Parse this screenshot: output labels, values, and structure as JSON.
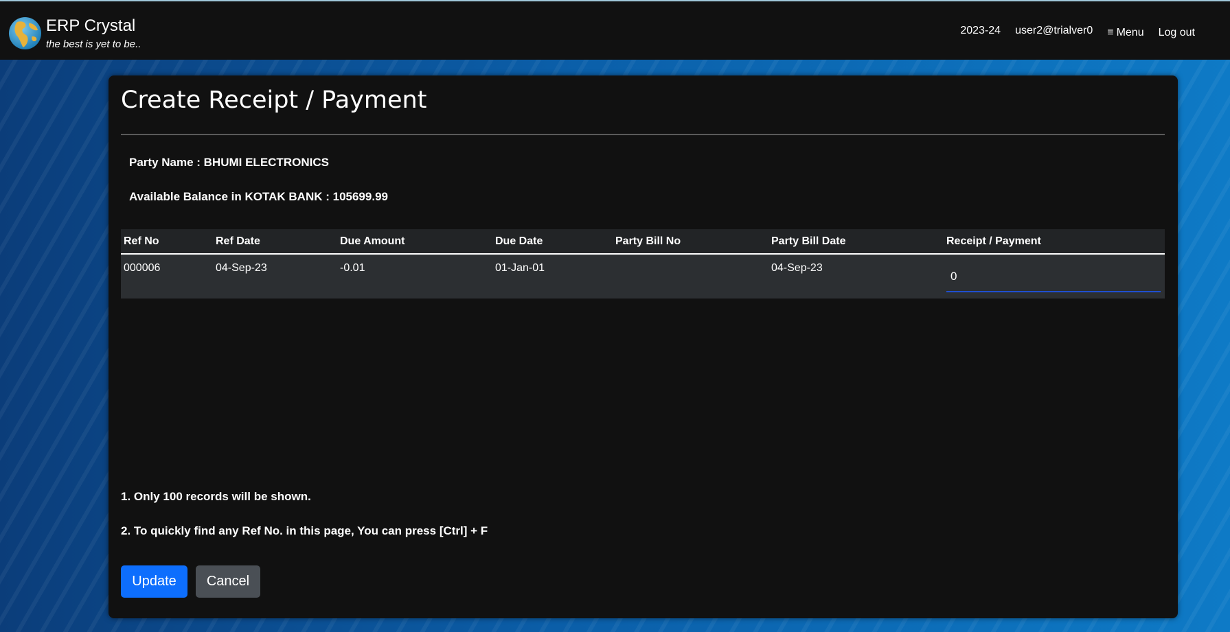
{
  "header": {
    "brand_title": "ERP Crystal",
    "brand_tagline": "the best is yet to be..",
    "financial_year": "2023-24",
    "user": "user2@trialver0",
    "menu_label": "Menu",
    "logout_label": "Log out"
  },
  "page": {
    "title": "Create Receipt / Payment",
    "party_name_line": "Party Name : BHUMI ELECTRONICS",
    "balance_line": "Available Balance in KOTAK BANK : 105699.99"
  },
  "table": {
    "columns": [
      "Ref No",
      "Ref Date",
      "Due Amount",
      "Due Date",
      "Party Bill No",
      "Party Bill Date",
      "Receipt / Payment"
    ],
    "rows": [
      {
        "ref_no": "000006",
        "ref_date": "04-Sep-23",
        "due_amount": "-0.01",
        "due_date": "01-Jan-01",
        "party_bill_no": "",
        "party_bill_date": "04-Sep-23",
        "receipt_payment": "0"
      }
    ]
  },
  "notes": {
    "note1": "1. Only 100 records will be shown.",
    "note2": "2. To quickly find any Ref No. in this page, You can press [Ctrl] + F"
  },
  "actions": {
    "update_label": "Update",
    "cancel_label": "Cancel"
  },
  "colors": {
    "primary": "#0d6efd",
    "secondary": "#4a4f55",
    "card_bg": "#111111",
    "row_bg": "#2c2f32"
  },
  "icons": {
    "logo": "globe-icon",
    "menu": "hamburger-icon"
  }
}
